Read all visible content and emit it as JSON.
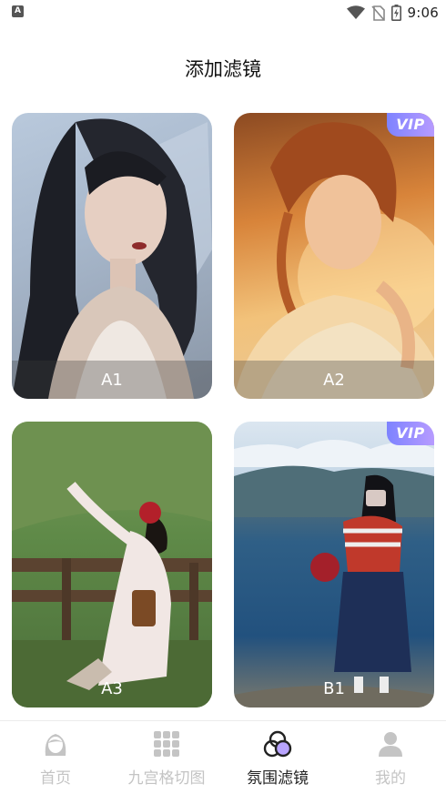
{
  "status_bar": {
    "left_icon": "A",
    "time": "9:06",
    "icons": [
      "wifi-icon",
      "no-sim-icon",
      "battery-charging-icon"
    ]
  },
  "title": "添加滤镜",
  "cards": [
    {
      "label": "A1",
      "vip": false
    },
    {
      "label": "A2",
      "vip": true,
      "badge": "VIP"
    },
    {
      "label": "A3",
      "vip": false
    },
    {
      "label": "B1",
      "vip": true,
      "badge": "VIP"
    }
  ],
  "tabs": [
    {
      "label": "首页",
      "icon": "girl-avatar-icon",
      "active": false
    },
    {
      "label": "九宫格切图",
      "icon": "nine-grid-icon",
      "active": false
    },
    {
      "label": "氛围滤镜",
      "icon": "filter-circles-icon",
      "active": true
    },
    {
      "label": "我的",
      "icon": "person-icon",
      "active": false
    }
  ],
  "colors": {
    "vip_badge_start": "#7d83ff",
    "vip_badge_end": "#b79bff",
    "tab_inactive": "#c4c4c4",
    "tab_active": "#222222"
  }
}
